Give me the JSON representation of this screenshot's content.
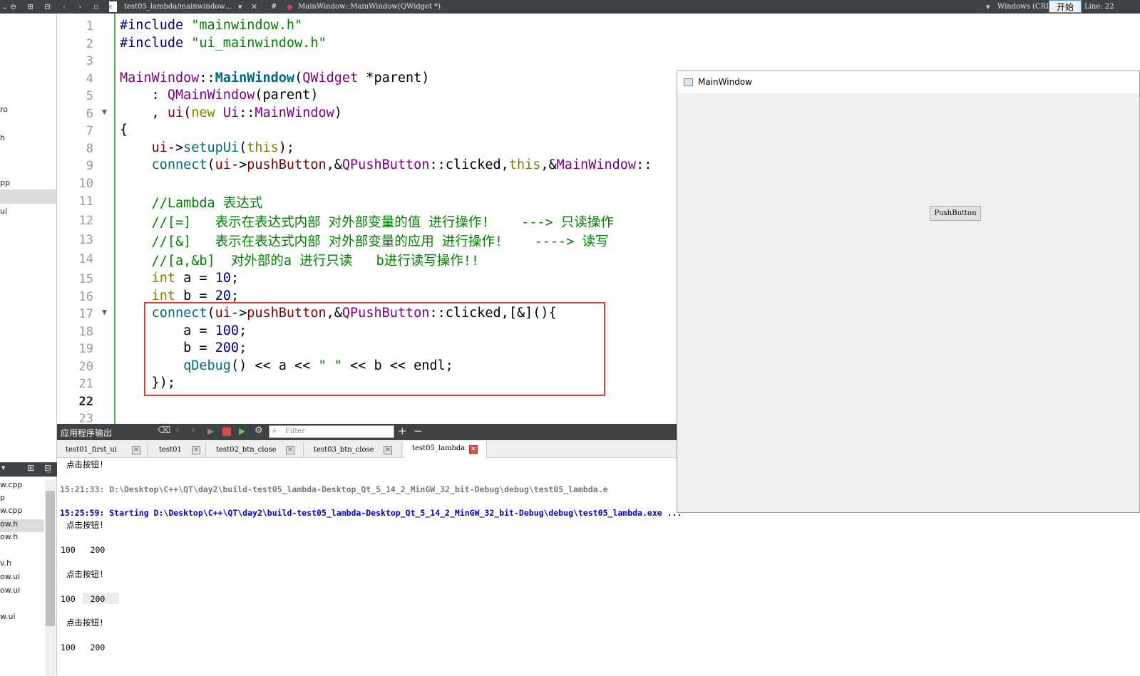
{
  "toolbar": {
    "file_tab": "test05_lambda/mainwindow…",
    "hash": "#",
    "function": "MainWindow::MainWindow(QWidget *)",
    "encoding": "Windows (CRL",
    "start_button": "开始",
    "line_info": "Line: 22"
  },
  "left_panel": {
    "items_top": [
      "ro",
      "h",
      "pp",
      "ui"
    ],
    "items_bottom": [
      "w.cpp",
      "p",
      "w.cpp",
      "ow.h",
      "ow.h",
      "v.h",
      "ow.ui",
      "ow.ui",
      "w.ui"
    ]
  },
  "editor": {
    "line_numbers": [
      "1",
      "2",
      "3",
      "4",
      "5",
      "6",
      "7",
      "8",
      "9",
      "10",
      "11",
      "12",
      "13",
      "14",
      "15",
      "16",
      "17",
      "18",
      "19",
      "20",
      "21",
      "22",
      "23"
    ],
    "current_line": "22"
  },
  "output_panel": {
    "title": "应用程序输出",
    "filter_placeholder": "Filter",
    "tabs": [
      "test01_first_ui",
      "test01",
      "test02_btn_close",
      "test03_btn_close",
      "test05_lambda"
    ],
    "active_tab": "test05_lambda",
    "lines": [
      {
        "text": "点击按钮!",
        "style": "blk"
      },
      {
        "text": "15:21:33: D:\\Desktop\\C++\\QT\\day2\\build-test05_lambda-Desktop_Qt_5_14_2_MinGW_32_bit-Debug\\debug\\test05_lambda.e",
        "style": "gray"
      },
      {
        "text": "15:25:59: Starting D:\\Desktop\\C++\\QT\\day2\\build-test05_lambda-Desktop_Qt_5_14_2_MinGW_32_bit-Debug\\debug\\test05_lambda.exe ...",
        "style": "blue"
      },
      {
        "text": "点击按钮!",
        "style": "blk"
      },
      {
        "text": "100   200",
        "style": "blk"
      },
      {
        "text": "点击按钮!",
        "style": "blk"
      },
      {
        "text": "100   200",
        "style": "blk"
      },
      {
        "text": "点击按钮!",
        "style": "blk"
      },
      {
        "text": "100   200",
        "style": "blk"
      }
    ]
  },
  "app_window": {
    "title": "MainWindow",
    "button_label": "PushButton"
  }
}
